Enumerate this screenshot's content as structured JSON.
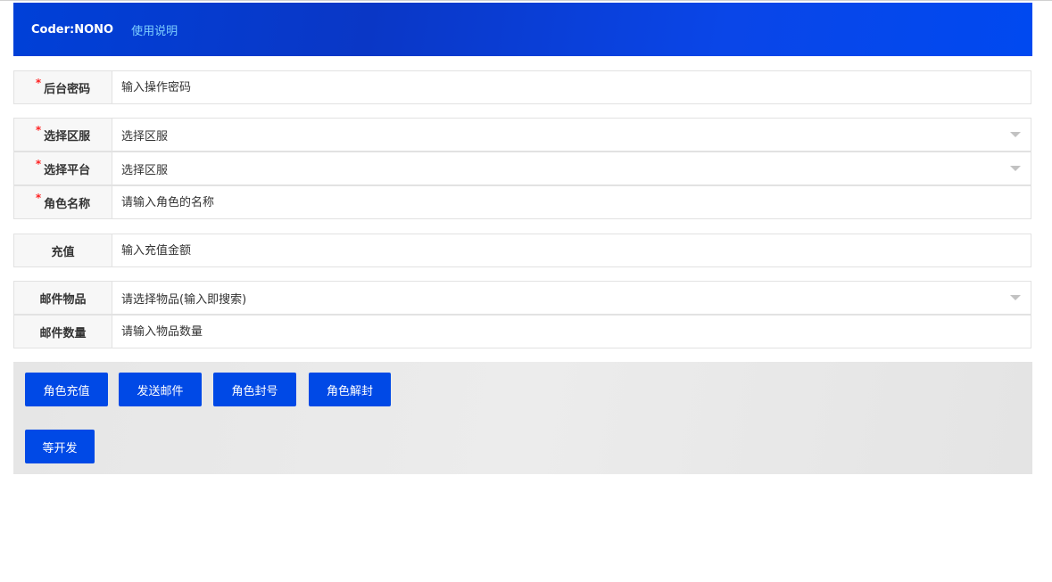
{
  "header": {
    "brand": "Coder:NONO",
    "help_link": "使用说明"
  },
  "form": {
    "password": {
      "label": "后台密码",
      "required": "*",
      "placeholder": "输入操作密码"
    },
    "server": {
      "label": "选择区服",
      "required": "*",
      "value": "选择区服"
    },
    "platform": {
      "label": "选择平台",
      "required": "*",
      "value": "选择区服"
    },
    "role_name": {
      "label": "角色名称",
      "required": "*",
      "placeholder": "请输入角色的名称"
    },
    "recharge": {
      "label": "充值",
      "placeholder": "输入充值金额"
    },
    "mail_item": {
      "label": "邮件物品",
      "value": "请选择物品(输入即搜索)"
    },
    "mail_quantity": {
      "label": "邮件数量",
      "placeholder": "请输入物品数量"
    }
  },
  "actions": {
    "role_recharge": "角色充值",
    "send_mail": "发送邮件",
    "ban_role": "角色封号",
    "unban_role": "角色解封",
    "pending_dev": "等开发"
  },
  "colors": {
    "primary": "#0049e6",
    "header_start": "#0040d8",
    "header_end": "#0049f0",
    "link": "#7fd0ff",
    "required": "#ff2222",
    "panel_bg": "#e8e8e8"
  }
}
